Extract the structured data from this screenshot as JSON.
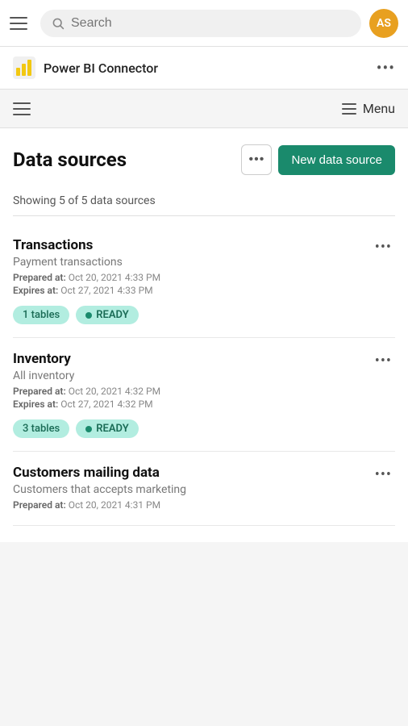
{
  "topBar": {
    "searchPlaceholder": "Search",
    "avatar": "AS",
    "avatarColor": "#e8a020"
  },
  "appHeader": {
    "title": "Power BI Connector",
    "moreLabel": "•••"
  },
  "navBar": {
    "menuLabel": "Menu"
  },
  "page": {
    "title": "Data sources",
    "optionsLabel": "•••",
    "newDataSourceLabel": "New data source",
    "summaryText": "Showing 5 of 5 data sources"
  },
  "dataSources": [
    {
      "name": "Transactions",
      "description": "Payment transactions",
      "preparedAt": "Oct 20, 2021 4:33 PM",
      "expiresAt": "Oct 27, 2021 4:33 PM",
      "tablesLabel": "1 tables",
      "status": "READY"
    },
    {
      "name": "Inventory",
      "description": "All inventory",
      "preparedAt": "Oct 20, 2021 4:32 PM",
      "expiresAt": "Oct 27, 2021 4:32 PM",
      "tablesLabel": "3 tables",
      "status": "READY"
    },
    {
      "name": "Customers mailing data",
      "description": "Customers that accepts marketing",
      "preparedAt": "Oct 20, 2021 4:31 PM",
      "expiresAt": null,
      "tablesLabel": null,
      "status": null
    }
  ],
  "labels": {
    "preparedAt": "Prepared at:",
    "expiresAt": "Expires at:"
  }
}
